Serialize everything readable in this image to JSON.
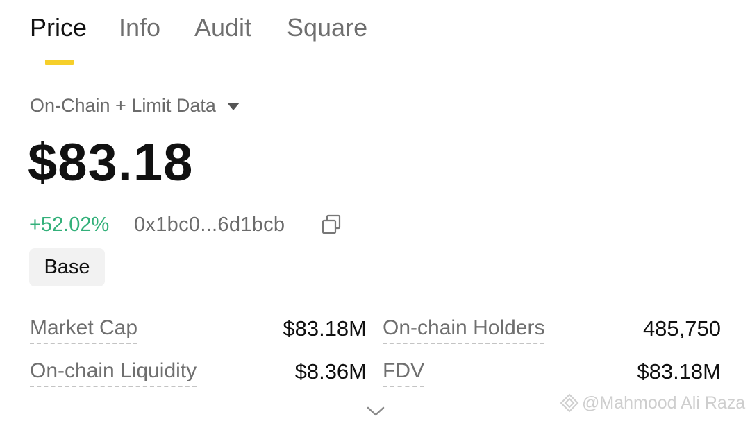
{
  "tabs": [
    {
      "label": "Price",
      "active": true
    },
    {
      "label": "Info",
      "active": false
    },
    {
      "label": "Audit",
      "active": false
    },
    {
      "label": "Square",
      "active": false
    }
  ],
  "data_source": {
    "label": "On-Chain + Limit Data",
    "icon": "caret-down-icon"
  },
  "price": "$83.18",
  "change": "+52.02%",
  "contract_address": "0x1bc0...6d1bcb",
  "chain": "Base",
  "stats": {
    "market_cap": {
      "label": "Market Cap",
      "value": "$83.18M"
    },
    "onchain_holders": {
      "label": "On-chain Holders",
      "value": "485,750"
    },
    "onchain_liquidity": {
      "label": "On-chain Liquidity",
      "value": "$8.36M"
    },
    "fdv": {
      "label": "FDV",
      "value": "$83.18M"
    }
  },
  "watermark": "@Mahmood Ali Raza",
  "colors": {
    "accent": "#f6cf2a",
    "positive": "#33b07a",
    "muted": "#6f6f6f"
  }
}
